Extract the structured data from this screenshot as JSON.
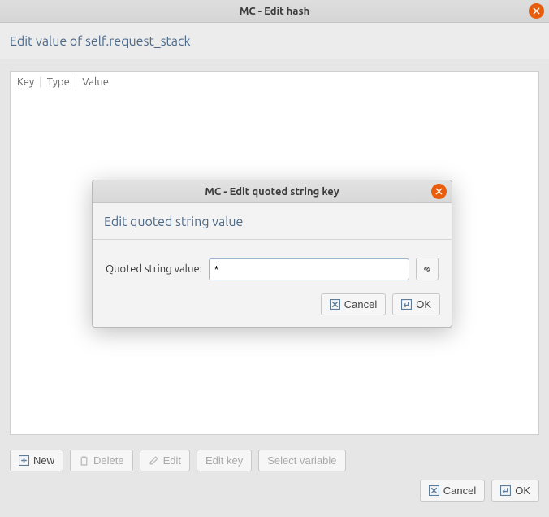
{
  "colors": {
    "accent": "#e85d0c",
    "header_text": "#4d6a89"
  },
  "window": {
    "title": "MC - Edit hash",
    "subheader": "Edit value of self.request_stack"
  },
  "table": {
    "columns": [
      "Key",
      "Type",
      "Value"
    ],
    "rows": []
  },
  "toolbar": {
    "new_label": "New",
    "delete_label": "Delete",
    "edit_label": "Edit",
    "editkey_label": "Edit key",
    "selectvar_label": "Select variable"
  },
  "footer": {
    "cancel_label": "Cancel",
    "ok_label": "OK"
  },
  "modal": {
    "title": "MC - Edit quoted string key",
    "subheader": "Edit quoted string value",
    "field_label": "Quoted string value:",
    "field_value": "*",
    "link_tooltip": "link",
    "cancel_label": "Cancel",
    "ok_label": "OK"
  }
}
